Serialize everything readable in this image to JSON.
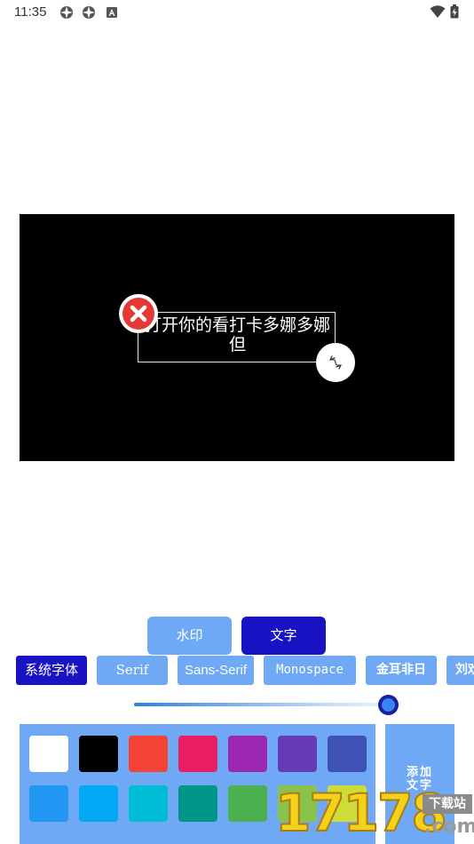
{
  "status_bar": {
    "time": "11:35",
    "icons": [
      "app-notification-icon",
      "app-notification-icon",
      "android-system-icon"
    ],
    "right_icons": [
      "wifi-icon",
      "battery-icon"
    ]
  },
  "canvas": {
    "text": "打开你的看打卡多娜多娜但",
    "background": "#000000",
    "text_color": "#ffffff",
    "delete_icon": "close-circle-icon",
    "resize_icon": "resize-rotate-icon"
  },
  "tabs": {
    "watermark": "水印",
    "text": "文字",
    "active": "text"
  },
  "fonts": {
    "items": [
      "系统字体",
      "Serif",
      "Sans-Serif",
      "Monospace",
      "金耳非日",
      "刘欢"
    ],
    "selected_index": 0
  },
  "slider": {
    "value": 1.0
  },
  "colors": {
    "swatches": [
      "#ffffff",
      "#000000",
      "#f44336",
      "#e91e63",
      "#9c27b0",
      "#673ab7",
      "#3f51b5",
      "#2196f3",
      "#03a9f4",
      "#00bcd4",
      "#009688",
      "#4caf50",
      "#8bc34a",
      "#cddc39"
    ],
    "accent": "#6fa8f5",
    "selected_tab_color": "#1a13c4"
  },
  "add_text_button": {
    "label_line1": "添加",
    "label_line2": "文字"
  },
  "watermark_logo": {
    "digits": "17178",
    "badge": "下载站",
    "domain": ".com"
  }
}
